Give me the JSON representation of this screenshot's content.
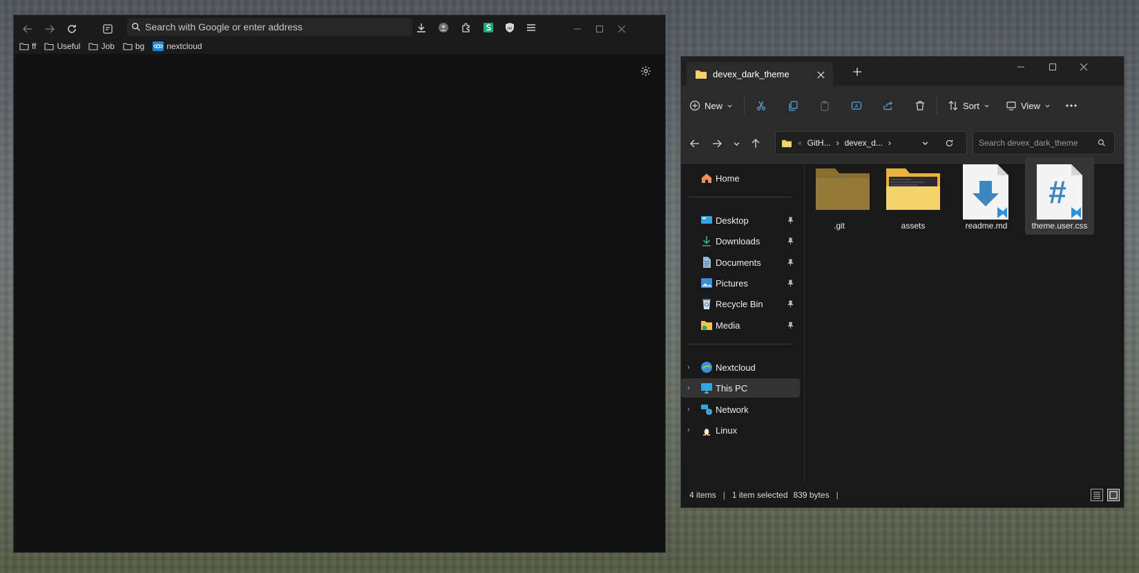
{
  "browser": {
    "search_placeholder": "Search with Google or enter address",
    "bookmarks": [
      {
        "label": "ff"
      },
      {
        "label": "Useful"
      },
      {
        "label": "Job"
      },
      {
        "label": "bg"
      },
      {
        "label": "nextcloud"
      }
    ],
    "accent": "#1fa97b"
  },
  "explorer": {
    "tab_title": "devex_dark_theme",
    "toolbar": {
      "new_label": "New",
      "sort_label": "Sort",
      "view_label": "View"
    },
    "address": {
      "crumbs": [
        "GitH...",
        "devex_d..."
      ],
      "search_placeholder": "Search devex_dark_theme"
    },
    "sidebar": {
      "home": "Home",
      "pinned": [
        {
          "label": "Desktop"
        },
        {
          "label": "Downloads"
        },
        {
          "label": "Documents"
        },
        {
          "label": "Pictures"
        },
        {
          "label": "Recycle Bin"
        },
        {
          "label": "Media"
        }
      ],
      "locations": [
        {
          "label": "Nextcloud"
        },
        {
          "label": "This PC"
        },
        {
          "label": "Network"
        },
        {
          "label": "Linux"
        }
      ]
    },
    "files": [
      {
        "name": ".git",
        "type": "folder"
      },
      {
        "name": "assets",
        "type": "folder"
      },
      {
        "name": "readme.md",
        "type": "file"
      },
      {
        "name": "theme.user.css",
        "type": "file"
      }
    ],
    "status": {
      "items": "4 items",
      "selected": "1 item selected",
      "size": "839 bytes"
    },
    "folder_color": "#f2c14e",
    "vscode_blue": "#2f8fd8"
  }
}
